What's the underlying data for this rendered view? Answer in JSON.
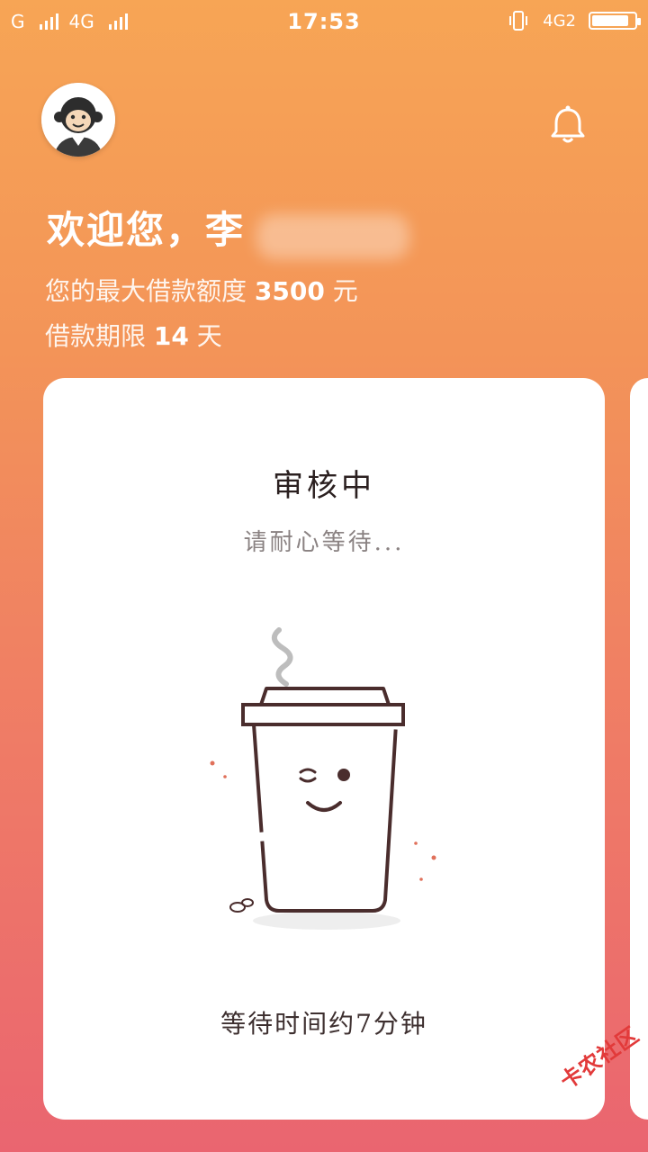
{
  "status_bar": {
    "carrier1": "G",
    "carrier2": "4G",
    "time": "17:53",
    "network": "4G2"
  },
  "header": {
    "avatar_icon": "monkey-avatar",
    "bell_icon": "bell-icon"
  },
  "welcome": {
    "greeting": "欢迎您，",
    "name_visible": "李"
  },
  "limits": {
    "amount_label": "您的最大借款额度",
    "amount_value": "3500",
    "amount_unit": "元",
    "term_label": "借款期限",
    "term_value": "14",
    "term_unit": "天"
  },
  "card": {
    "title": "审核中",
    "subtitle": "请耐心等待...",
    "wait_text": "等待时间约7分钟",
    "illustration": "coffee-cup-icon"
  },
  "watermark": {
    "text": "卡农社区"
  },
  "colors": {
    "gradient_top": "#f7a555",
    "gradient_bottom": "#ea6570",
    "cup_stroke": "#4a2d2d"
  }
}
